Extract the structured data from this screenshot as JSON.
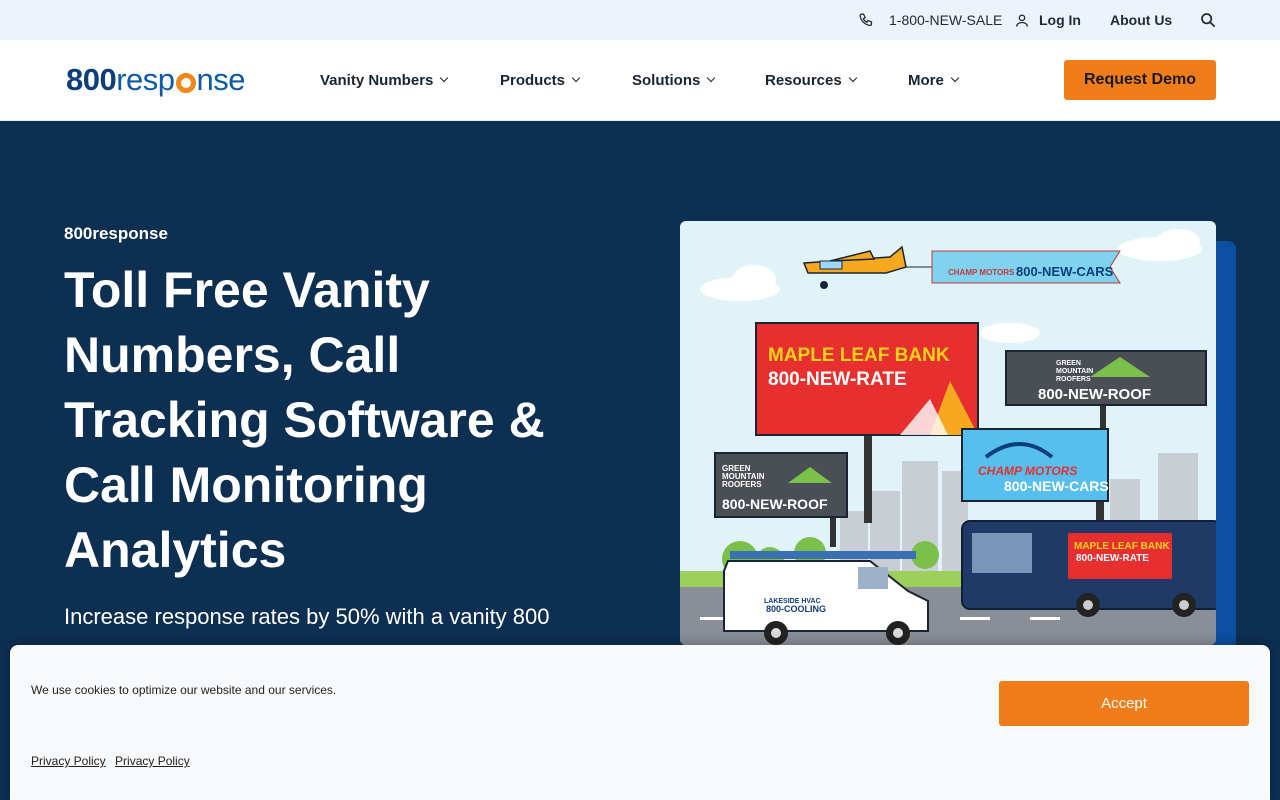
{
  "utility": {
    "phone": "1-800-NEW-SALE",
    "login": "Log In",
    "about": "About Us"
  },
  "nav": {
    "logo_prefix": "800",
    "logo_mid": "resp",
    "logo_suffix": "nse",
    "items": [
      {
        "label": "Vanity Numbers"
      },
      {
        "label": "Products"
      },
      {
        "label": "Solutions"
      },
      {
        "label": "Resources"
      },
      {
        "label": "More"
      }
    ],
    "cta": "Request Demo"
  },
  "hero": {
    "eyebrow": "800response",
    "title": "Toll Free Vanity Numbers, Call Tracking Software & Call Monitoring Analytics",
    "subtitle": "Increase response rates by 50% with a vanity 800"
  },
  "illustration": {
    "banner_brand": "CHAMP MOTORS",
    "banner_number": "800-NEW-CARS",
    "bank_name": "MAPLE LEAF BANK",
    "bank_number": "800-NEW-RATE",
    "roof_name_1": "GREEN",
    "roof_name_2": "MOUNTAIN",
    "roof_name_3": "ROOFERS",
    "roof_number": "800-NEW-ROOF",
    "motors_brand": "CHAMP MOTORS",
    "motors_number": "800-NEW-CARS",
    "van_brand": "LAKESIDE HVAC",
    "van_number": "800-COOLING",
    "bus_brand": "MAPLE LEAF BANK",
    "bus_number": "800-NEW-RATE"
  },
  "cookie": {
    "message": "We use cookies to optimize our website and our services.",
    "accept": "Accept",
    "link1": "Privacy Policy",
    "link2": "Privacy Policy"
  },
  "colors": {
    "navy": "#0d2f52",
    "accent": "#f07c1a",
    "brand_blue": "#0c3e7b"
  }
}
